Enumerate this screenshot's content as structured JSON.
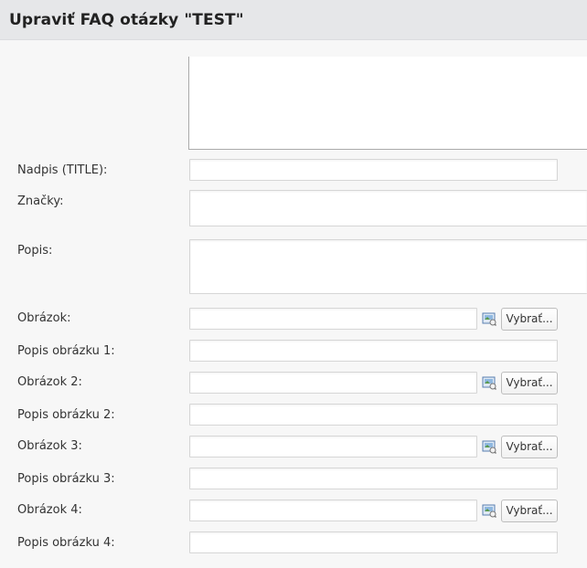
{
  "header": {
    "title": "Upraviť FAQ otázky \"TEST\""
  },
  "form": {
    "title_label": "Nadpis (TITLE):",
    "tags_label": "Značky:",
    "description_label": "Popis:",
    "images": [
      {
        "image_label": "Obrázok:",
        "caption_label": "Popis obrázku 1:",
        "button_label": "Vybrať..."
      },
      {
        "image_label": "Obrázok 2:",
        "caption_label": "Popis obrázku 2:",
        "button_label": "Vybrať..."
      },
      {
        "image_label": "Obrázok 3:",
        "caption_label": "Popis obrázku 3:",
        "button_label": "Vybrať..."
      },
      {
        "image_label": "Obrázok 4:",
        "caption_label": "Popis obrázku 4:",
        "button_label": "Vybrať..."
      }
    ]
  },
  "icons": {
    "browse": "image-browse-icon"
  },
  "colors": {
    "header_bg": "#e6e7e9",
    "page_bg": "#f7f7f7",
    "field_border": "#d6d6d6"
  }
}
